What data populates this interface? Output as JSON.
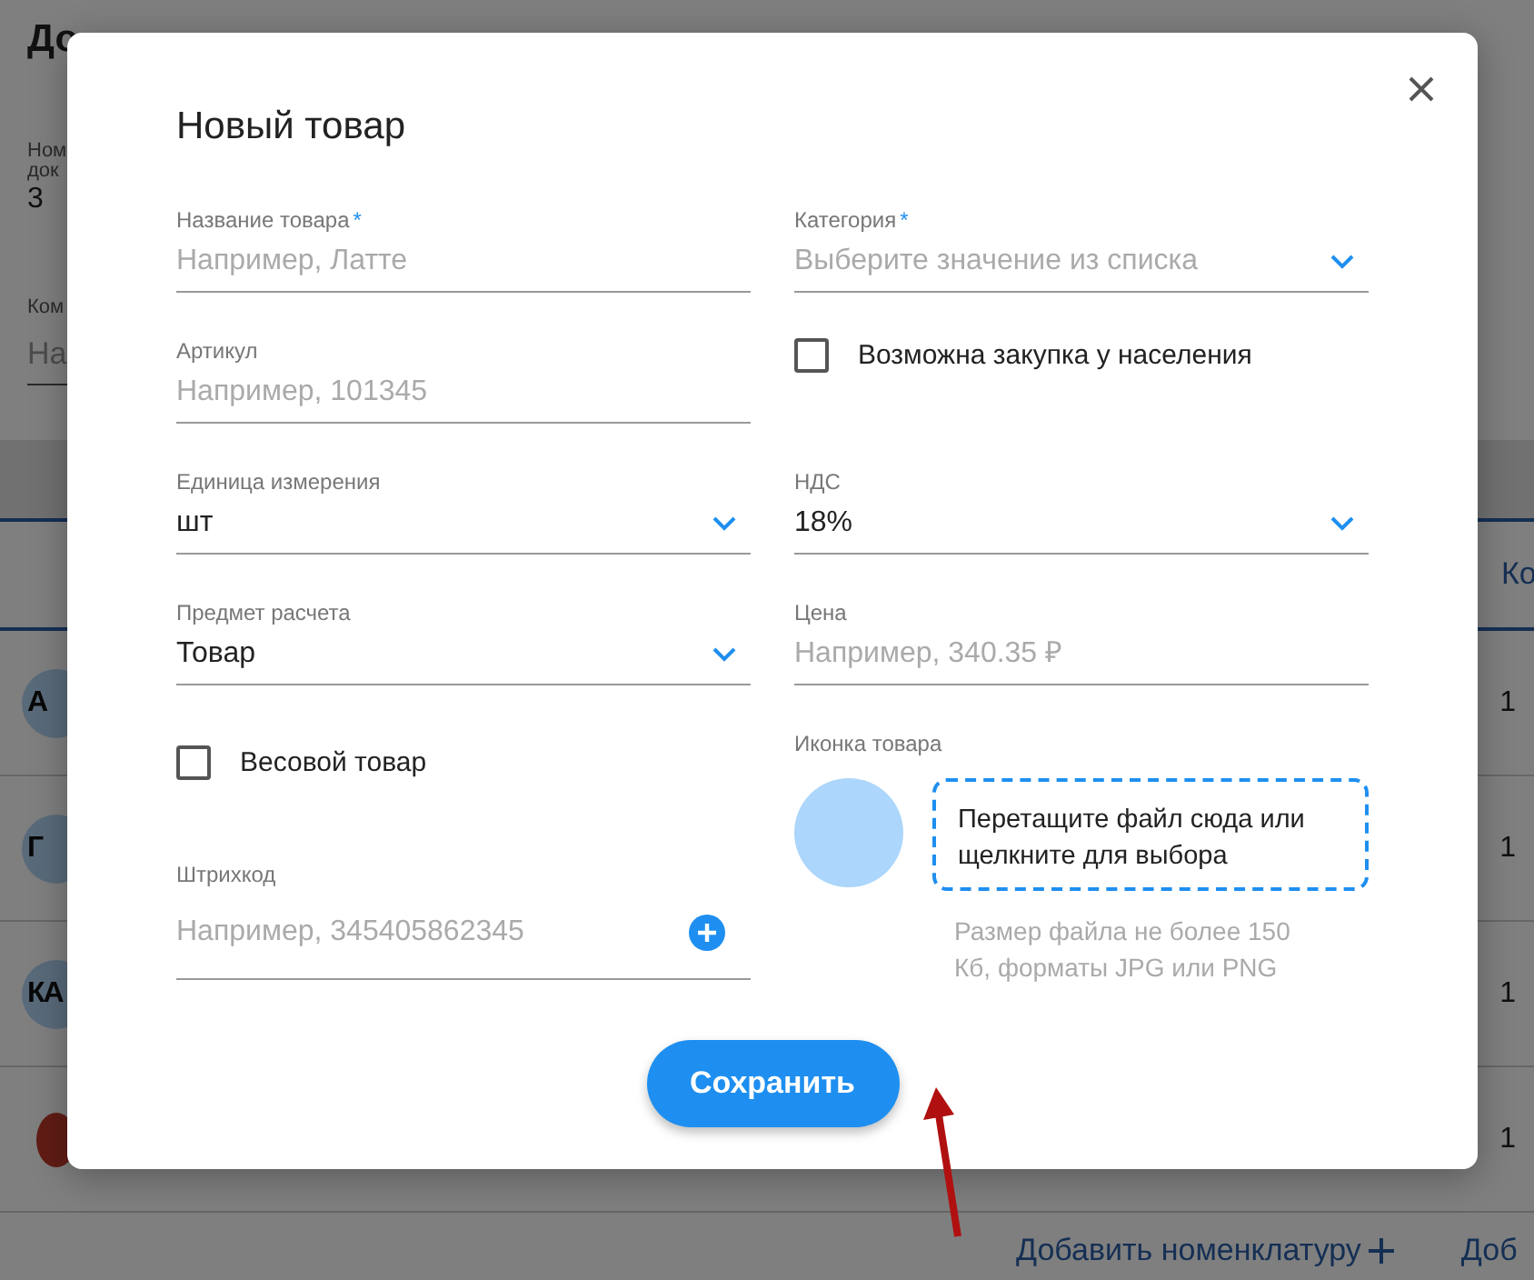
{
  "background": {
    "title": "До",
    "number_label": [
      "Ном",
      "док"
    ],
    "number_value": "3",
    "comment_label": "Ком",
    "comment_placeholder": "На",
    "column_header": "Ко",
    "rows": [
      {
        "kind": "avatar",
        "initials": "А",
        "quantity": "1"
      },
      {
        "kind": "avatar",
        "initials": "Г",
        "quantity": "1"
      },
      {
        "kind": "avatar",
        "initials": "КА",
        "quantity": "1"
      },
      {
        "kind": "photo",
        "quantity": "1"
      }
    ],
    "add_link": "Добавить номенклатуру",
    "footer_cut": "Доб"
  },
  "dialog": {
    "title": "Новый товар",
    "left_fields": [
      {
        "kind": "text",
        "label": "Название товара",
        "required_mark": "*",
        "placeholder": "Например, Латте"
      },
      {
        "kind": "text",
        "label": "Артикул",
        "placeholder": "Например, 101345"
      },
      {
        "kind": "select",
        "label": "Единица измерения",
        "value": "шт"
      },
      {
        "kind": "select",
        "label": "Предмет расчета",
        "value": "Товар"
      },
      {
        "kind": "checkbox",
        "label": "Весовой товар",
        "checked": false
      },
      {
        "kind": "barcode",
        "label": "Штрихкод",
        "placeholder": "Например, 345405862345"
      }
    ],
    "right_fields": [
      {
        "kind": "select",
        "label": "Категория",
        "required_mark": "*",
        "placeholder": "Выберите значение из списка"
      },
      {
        "kind": "checkbox",
        "label": "Возможна закупка у населения",
        "checked": false
      },
      {
        "kind": "select",
        "label": "НДС",
        "value": "18%"
      },
      {
        "kind": "text",
        "label": "Цена",
        "placeholder": "Например, 340.35 ₽"
      },
      {
        "kind": "upload",
        "label": "Иконка товара",
        "dropzone_text": "Перетащите файл сюда или щелкните для выбора",
        "hint": "Размер файла не более 150 Кб, форматы JPG или PNG"
      }
    ],
    "save_button": "Сохранить"
  }
}
